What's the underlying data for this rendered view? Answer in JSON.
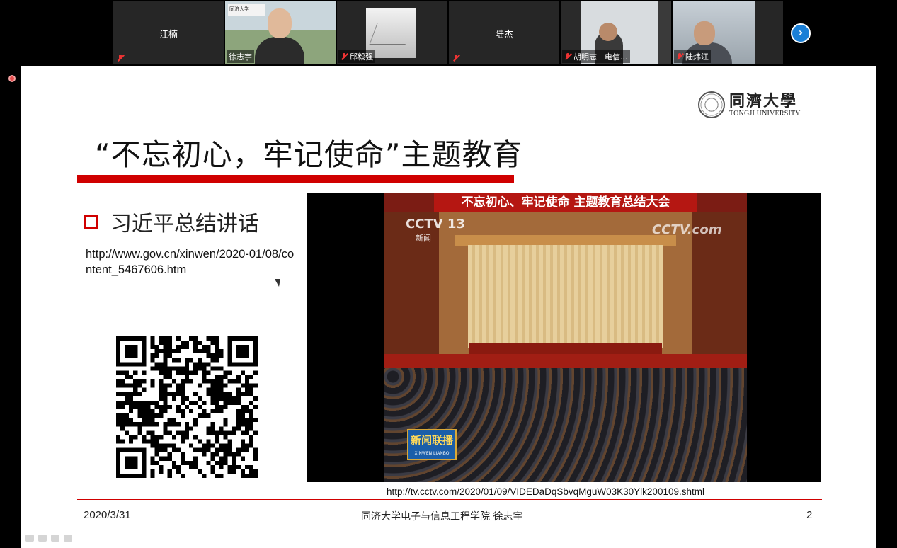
{
  "participants": [
    {
      "name": "江楠",
      "video": false
    },
    {
      "name": "徐志宇",
      "video": true,
      "active": true,
      "sign_text": "同济大学"
    },
    {
      "name": "邱毅强",
      "video": true
    },
    {
      "name": "陆杰",
      "video": false
    },
    {
      "name": "胡明志　电信...",
      "video": true
    },
    {
      "name": "陆炜江",
      "video": true
    }
  ],
  "next_icon": "›",
  "slide": {
    "logo_cn": "同濟大學",
    "logo_en": "TONGJI UNIVERSITY",
    "title": "“不忘初心，牢记使命”主题教育",
    "bullet": "习近平总结讲话",
    "link1": "http://www.gov.cn/xinwen/2020-01/08/content_5467606.htm",
    "video": {
      "banner": "不忘初心、牢记使命 主题教育总结大会",
      "channel": "CCTV 13",
      "channel_sub": "新闻",
      "watermark": "CCTV.com",
      "program": "新闻联播",
      "program_en": "XINWEN LIANBO"
    },
    "link2": "http://tv.cctv.com/2020/01/09/VIDEDaDqSbvqMguW03K30Ylk200109.shtml",
    "footer_date": "2020/3/31",
    "footer_center": "同济大学电子与信息工程学院 徐志宇",
    "footer_page": "2"
  },
  "colors": {
    "accent_red": "#d00000",
    "active_outline": "#d8e25a",
    "next_button": "#1a7fd6"
  }
}
